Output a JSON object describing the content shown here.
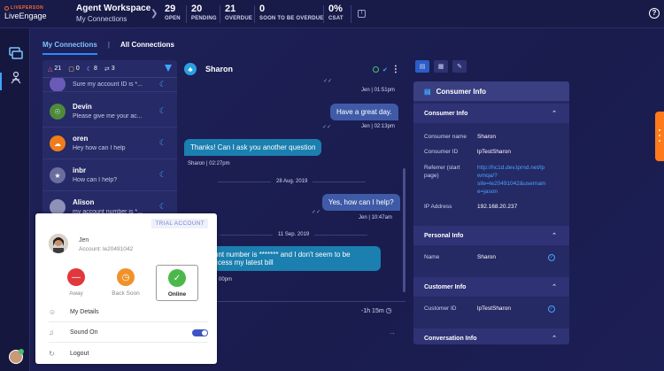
{
  "header": {
    "brand_top": "LIVEPERSON",
    "brand_bottom": "LiveEngage",
    "workspace_title": "Agent Workspace",
    "workspace_sub": "My Connections",
    "stats": [
      {
        "value": "29",
        "label": "OPEN"
      },
      {
        "value": "20",
        "label": "PENDING"
      },
      {
        "value": "21",
        "label": "OVERDUE"
      },
      {
        "value": "0",
        "label": "SOON TO BE OVERDUE"
      },
      {
        "value": "0%",
        "label": "CSAT"
      }
    ],
    "info_icon": "!",
    "help_icon": "?"
  },
  "tabs": {
    "my": "My Connections",
    "all": "All Connections",
    "sep": "|"
  },
  "counts": {
    "alerts": "21",
    "messages": "0",
    "away": "8",
    "transfers": "3"
  },
  "conversations": [
    {
      "name": "",
      "preview": "Sure my account ID is *...",
      "avatar_color": "#6a5ab8",
      "icon": ""
    },
    {
      "name": "Devin",
      "preview": "Please give me your ac...",
      "avatar_color": "#4e8a3b",
      "icon": "☉"
    },
    {
      "name": "oren",
      "preview": "Hey how can I help",
      "avatar_color": "#f07c1b",
      "icon": "☁"
    },
    {
      "name": "inbr",
      "preview": "How can I help?",
      "avatar_color": "#6a6e9e",
      "icon": "★"
    },
    {
      "name": "Alison",
      "preview": "my account number is *...",
      "avatar_color": "#8e92b8",
      "icon": ""
    }
  ],
  "chat": {
    "name": "Sharon",
    "messages": [
      {
        "meta": "Jen | 01:51pm"
      },
      {
        "text": "Have a great day.",
        "meta": "Jen | 02:13pm"
      },
      {
        "text": "Thanks! Can I ask you another question",
        "meta": "Sharon | 02:27pm"
      },
      {
        "date": "28 Aug. 2019"
      },
      {
        "text": "Yes, how can I help?",
        "meta": "Jen | 10:47am"
      },
      {
        "date": "11 Sep. 2019"
      },
      {
        "text": "unt number is ******* and I don't seem to be",
        "text2": "ccess my latest bill",
        "meta": "00pm"
      }
    ],
    "timer": "-1h 15m",
    "send_icon": "→"
  },
  "consumer": {
    "title": "Consumer Info",
    "sections": {
      "consumer": "Consumer Info",
      "personal": "Personal Info",
      "customer": "Customer Info",
      "conversation": "Conversation Info"
    },
    "fields": {
      "name_label": "Consumer name",
      "name": "Sharon",
      "id_label": "Consumer ID",
      "id": "lpTestSharon",
      "ref_label": "Referrer (start page)",
      "ref_lines": [
        "http://hc1d.dev.lprnd.net/lp",
        "wmqa/?",
        "site=le20491042&usernam",
        "e=jason"
      ],
      "ip_label": "IP Address",
      "ip": "192.168.20.237",
      "p_name_label": "Name",
      "p_name": "Sharon",
      "c_id_label": "Customer ID",
      "c_id": "lpTestSharon"
    }
  },
  "agent_popup": {
    "badge": "TRIAL ACCOUNT",
    "name": "Jen",
    "account": "Account: le20491042",
    "statuses": [
      {
        "label": "Away",
        "color": "#e0383b",
        "icon": "—"
      },
      {
        "label": "Back Soon",
        "color": "#f0922a",
        "icon": "◷"
      },
      {
        "label": "Online",
        "color": "#4cb84a",
        "icon": "✓"
      }
    ],
    "menu": [
      {
        "label": "My Details",
        "icon": "☺"
      },
      {
        "label": "Sound On",
        "icon": "♫"
      },
      {
        "label": "Logout",
        "icon": "↻"
      }
    ]
  }
}
